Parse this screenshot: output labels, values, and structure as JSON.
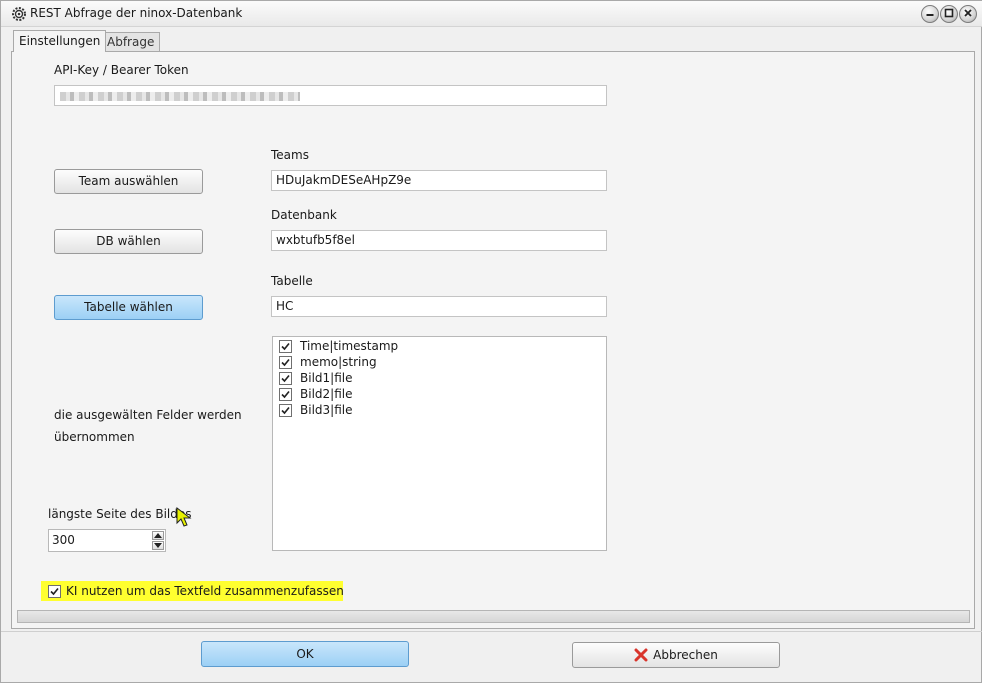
{
  "window": {
    "title": "REST Abfrage der ninox-Datenbank",
    "icons": [
      "app-gear-icon",
      "minimize-icon",
      "maximize-icon",
      "close-icon"
    ]
  },
  "tabs": [
    {
      "label": "Einstellungen",
      "active": true
    },
    {
      "label": "Abfrage",
      "active": false
    }
  ],
  "api": {
    "label": "API-Key / Bearer Token",
    "value": ""
  },
  "team": {
    "button_label": "Team auswählen",
    "field_label": "Teams",
    "value": "HDuJakmDESeAHpZ9e"
  },
  "db": {
    "button_label": "DB wählen",
    "field_label": "Datenbank",
    "value": "wxbtufb5f8el"
  },
  "table": {
    "button_label": "Tabelle wählen",
    "field_label": "Tabelle",
    "value": "HC"
  },
  "fields": {
    "note_line1": "die ausgewälten Felder werden",
    "note_line2": "übernommen",
    "items": [
      {
        "label": "Time|timestamp",
        "checked": true
      },
      {
        "label": "memo|string",
        "checked": true
      },
      {
        "label": "Bild1|file",
        "checked": true
      },
      {
        "label": "Bild2|file",
        "checked": true
      },
      {
        "label": "Bild3|file",
        "checked": true
      }
    ]
  },
  "image_size": {
    "label": "längste Seite des Bildes",
    "value": "300"
  },
  "ki": {
    "label": "KI nutzen um das Textfeld zusammenzufassen",
    "checked": true,
    "highlight_color": "#ffff2f"
  },
  "footer": {
    "ok_label": "OK",
    "cancel_label": "Abbrechen",
    "cancel_icon": "red-x-icon"
  },
  "colors": {
    "active_button": "#9cd0f5",
    "cancel_icon": "#d9342b"
  }
}
